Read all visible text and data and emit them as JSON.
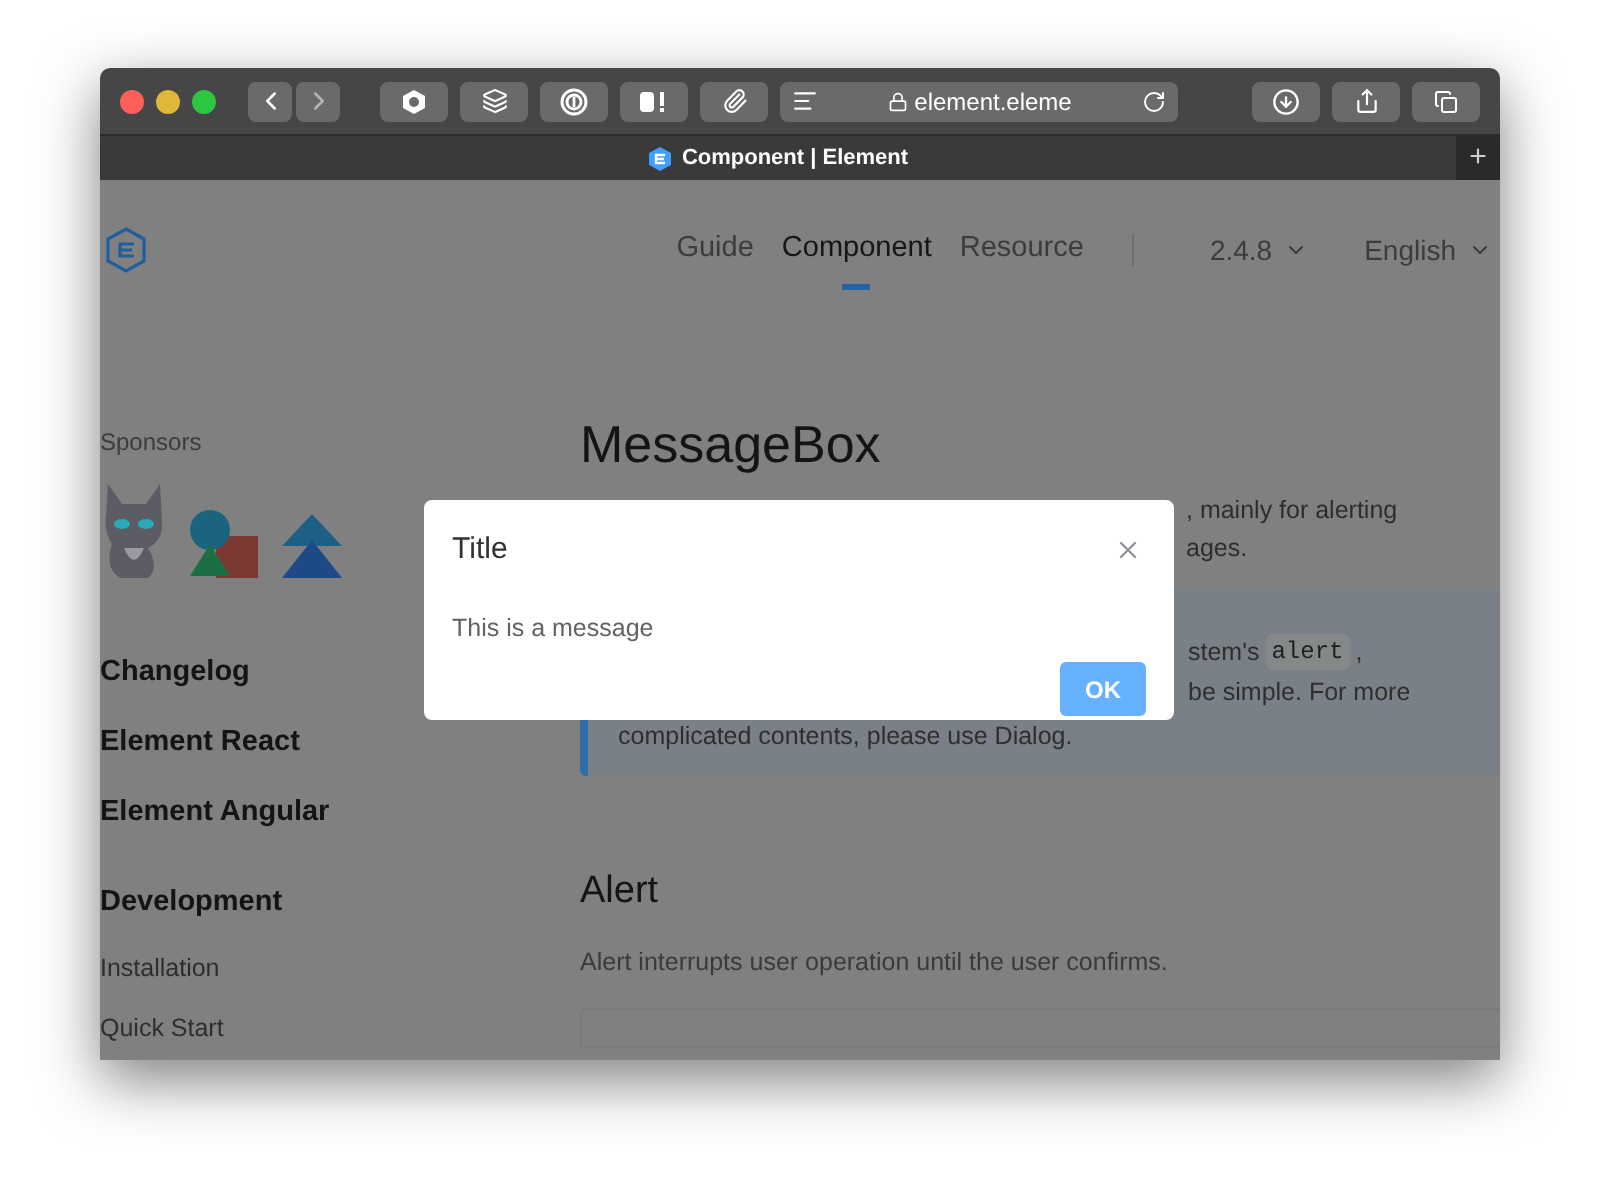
{
  "browser": {
    "address": "element.eleme",
    "tab_title": "Component | Element",
    "new_tab": "+"
  },
  "nav": {
    "items": [
      {
        "label": "Guide",
        "selected": false
      },
      {
        "label": "Component",
        "selected": true
      },
      {
        "label": "Resource",
        "selected": false
      }
    ],
    "version": "2.4.8",
    "language": "English"
  },
  "sidebar": {
    "sponsors_label": "Sponsors",
    "links": [
      "Changelog",
      "Element React",
      "Element Angular"
    ],
    "section": "Development",
    "items": [
      "Installation",
      "Quick Start"
    ]
  },
  "main": {
    "title": "MessageBox",
    "intro_fragments": [
      ", mainly for alerting",
      "ages."
    ],
    "info_lines": [
      {
        "text": "stem's ",
        "code": "alert",
        "after": " ,"
      },
      {
        "text": "be simple. For more"
      },
      {
        "text": "complicated contents, please use Dialog."
      }
    ],
    "section_title": "Alert",
    "section_text": "Alert interrupts user operation until the user confirms."
  },
  "dialog": {
    "title": "Title",
    "message": "This is a message",
    "button": "OK"
  }
}
